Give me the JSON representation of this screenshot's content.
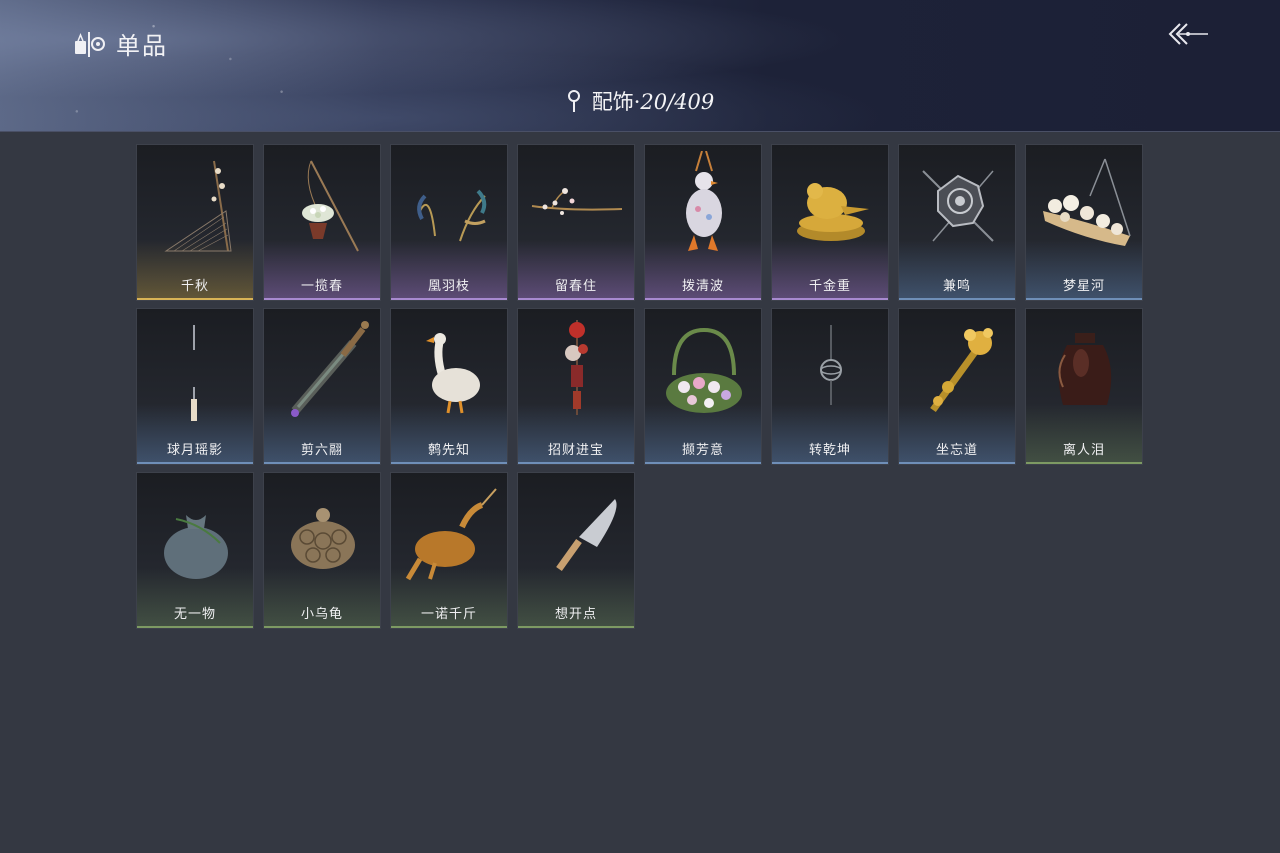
{
  "header": {
    "title": "单品",
    "back_icon": "back-arrow-icon",
    "brand_icon": "wardrobe-icon"
  },
  "category": {
    "name": "配饰",
    "separator": "·",
    "count": "20/409",
    "icon": "location-pin-icon"
  },
  "colors": {
    "background": "#343842",
    "gold": "#d8b356",
    "purple": "#a88ad0",
    "blue": "#6f8fb8",
    "green": "#7d9a63"
  },
  "items": [
    {
      "name": "千秋",
      "quality": "gold",
      "icon": "swing-bench-icon"
    },
    {
      "name": "一揽春",
      "quality": "purple",
      "icon": "flower-basket-pole-icon"
    },
    {
      "name": "凰羽枝",
      "quality": "purple",
      "icon": "feather-branch-icon"
    },
    {
      "name": "留春住",
      "quality": "purple",
      "icon": "blossom-branch-icon"
    },
    {
      "name": "拨清波",
      "quality": "purple",
      "icon": "goose-pendant-icon"
    },
    {
      "name": "千金重",
      "quality": "purple",
      "icon": "golden-bird-icon"
    },
    {
      "name": "兼鸣",
      "quality": "blue",
      "icon": "ornate-medallion-icon"
    },
    {
      "name": "梦星河",
      "quality": "blue",
      "icon": "flower-swing-icon"
    },
    {
      "name": "球月瑶影",
      "quality": "blue",
      "icon": "crescent-pendant-icon"
    },
    {
      "name": "剪六翮",
      "quality": "blue",
      "icon": "short-sword-icon"
    },
    {
      "name": "鹩先知",
      "quality": "blue",
      "icon": "white-goose-icon"
    },
    {
      "name": "招财进宝",
      "quality": "blue",
      "icon": "lucky-charm-icon"
    },
    {
      "name": "撷芳意",
      "quality": "blue",
      "icon": "flower-wreath-icon"
    },
    {
      "name": "转乾坤",
      "quality": "blue",
      "icon": "armillary-pendant-icon"
    },
    {
      "name": "坐忘道",
      "quality": "blue",
      "icon": "golden-scepter-icon"
    },
    {
      "name": "离人泪",
      "quality": "green",
      "icon": "wine-jar-icon"
    },
    {
      "name": "无一物",
      "quality": "green",
      "icon": "cloth-sack-icon"
    },
    {
      "name": "小乌龟",
      "quality": "green",
      "icon": "turtle-icon"
    },
    {
      "name": "一诺千斤",
      "quality": "green",
      "icon": "roast-chicken-icon"
    },
    {
      "name": "想开点",
      "quality": "green",
      "icon": "kitchen-knife-icon"
    }
  ]
}
